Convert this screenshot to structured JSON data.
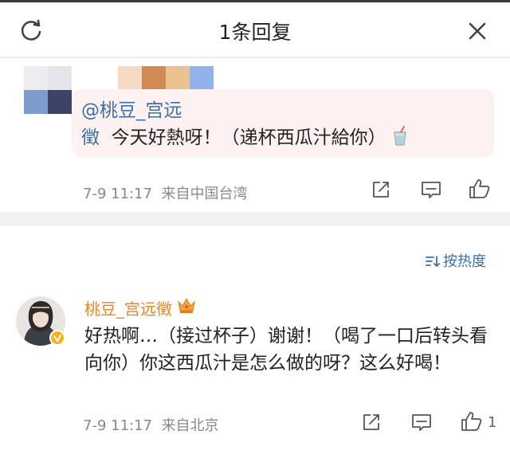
{
  "header": {
    "title": "1条回复"
  },
  "reply": {
    "mention": "@桃豆_宫远徵",
    "text": "今天好熱呀！（递杯西瓜汁給你）",
    "time": "7-9 11:17",
    "source": "来自中国台湾"
  },
  "sort": {
    "label": "按热度"
  },
  "comment": {
    "username": "桃豆_宫远徵",
    "text": "好热啊…（接过杯子）谢谢！（喝了一口后转头看向你）你这西瓜汁是怎么做的呀？这么好喝！",
    "time": "7-9 11:17",
    "source": "来自北京",
    "like_count": "1"
  },
  "colors": {
    "mention": "#3d6fa8",
    "username": "#e2872d",
    "quote_bg": "#fdf1f2",
    "meta": "#888888"
  },
  "icons": [
    "refresh-icon",
    "close-icon",
    "share-icon",
    "comment-icon",
    "like-icon",
    "sort-icon",
    "crown-icon",
    "cup-icon"
  ]
}
